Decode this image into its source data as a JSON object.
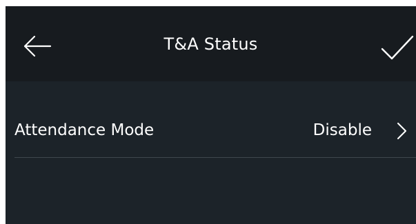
{
  "header": {
    "title": "T&A Status",
    "back_icon": "arrow-left-icon",
    "confirm_icon": "checkmark-icon"
  },
  "settings": {
    "rows": [
      {
        "label": "Attendance Mode",
        "value": "Disable",
        "icon": "chevron-right-icon"
      }
    ]
  },
  "colors": {
    "header_background": "#171b1f",
    "page_background": "#1c2329",
    "text": "#ffffff",
    "divider": "#3f474e"
  }
}
